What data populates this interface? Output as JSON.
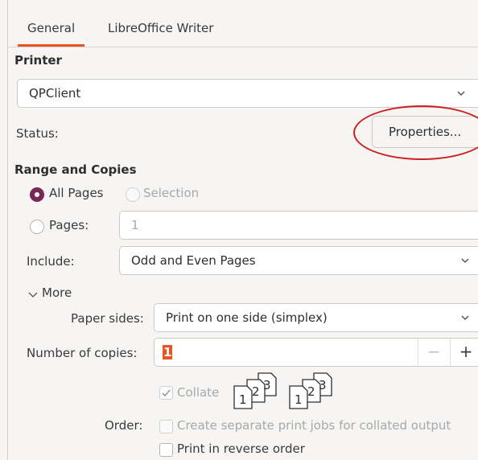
{
  "tabs": [
    {
      "label": "General",
      "active": true
    },
    {
      "label": "LibreOffice Writer",
      "active": false
    }
  ],
  "printer": {
    "section_title": "Printer",
    "selected": "QPClient",
    "status_label": "Status:",
    "properties_button": "Properties..."
  },
  "range": {
    "section_title": "Range and Copies",
    "all_pages_label": "All Pages",
    "all_pages_checked": true,
    "selection_label": "Selection",
    "selection_enabled": false,
    "pages_label": "Pages:",
    "pages_value": "1",
    "include_label": "Include:",
    "include_value": "Odd and Even Pages"
  },
  "more": {
    "toggle_label": "More",
    "expanded": true,
    "paper_sides_label": "Paper sides:",
    "paper_sides_value": "Print on one side (simplex)",
    "copies_label": "Number of copies:",
    "copies_value": "1",
    "minus": "−",
    "plus": "+",
    "collate_label": "Collate",
    "collate_checked": true,
    "collate_enabled": false,
    "order_label": "Order:",
    "separate_jobs_label": "Create separate print jobs for collated output",
    "separate_jobs_enabled": false,
    "reverse_label": "Print in reverse order",
    "reverse_checked": false
  },
  "colors": {
    "accent": "#e95420",
    "radio_selected": "#772953",
    "highlight_oval": "#cc1f1f"
  }
}
